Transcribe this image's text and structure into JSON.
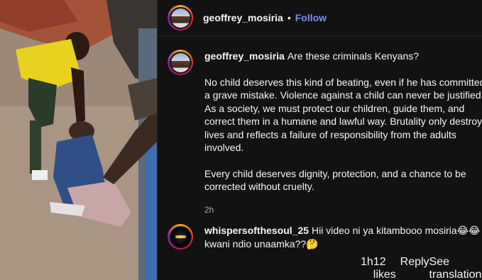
{
  "header": {
    "username": "geoffrey_mosiria",
    "separator": "•",
    "follow_label": "Follow"
  },
  "post": {
    "username": "geoffrey_mosiria",
    "caption_lead": "Are these criminals Kenyans?",
    "paragraph_1": "No child deserves this kind of beating, even if he has committed a grave mistake. Violence against a child can never be justified. As a society, we must protect our children, guide them, and correct them in a humane and lawful way. Brutality only destroys lives and reflects a failure of responsibility from the adults involved.",
    "paragraph_2": "Every child deserves dignity, protection, and a chance to be corrected without cruelty.",
    "time": "2h"
  },
  "comment": {
    "username": "whispersofthesoul_25",
    "text": "Hii video ni ya kitambooo mosiria😂😂 kwani ndio unaamka??🤔",
    "time": "1h",
    "likes": "12 likes",
    "reply_label": "Reply",
    "translate_label": "See translation"
  },
  "media": {
    "description_icon": "video-still"
  },
  "colors": {
    "follow": "#7c8cff",
    "panel_bg": "#121212",
    "muted": "#a8a8a8"
  }
}
